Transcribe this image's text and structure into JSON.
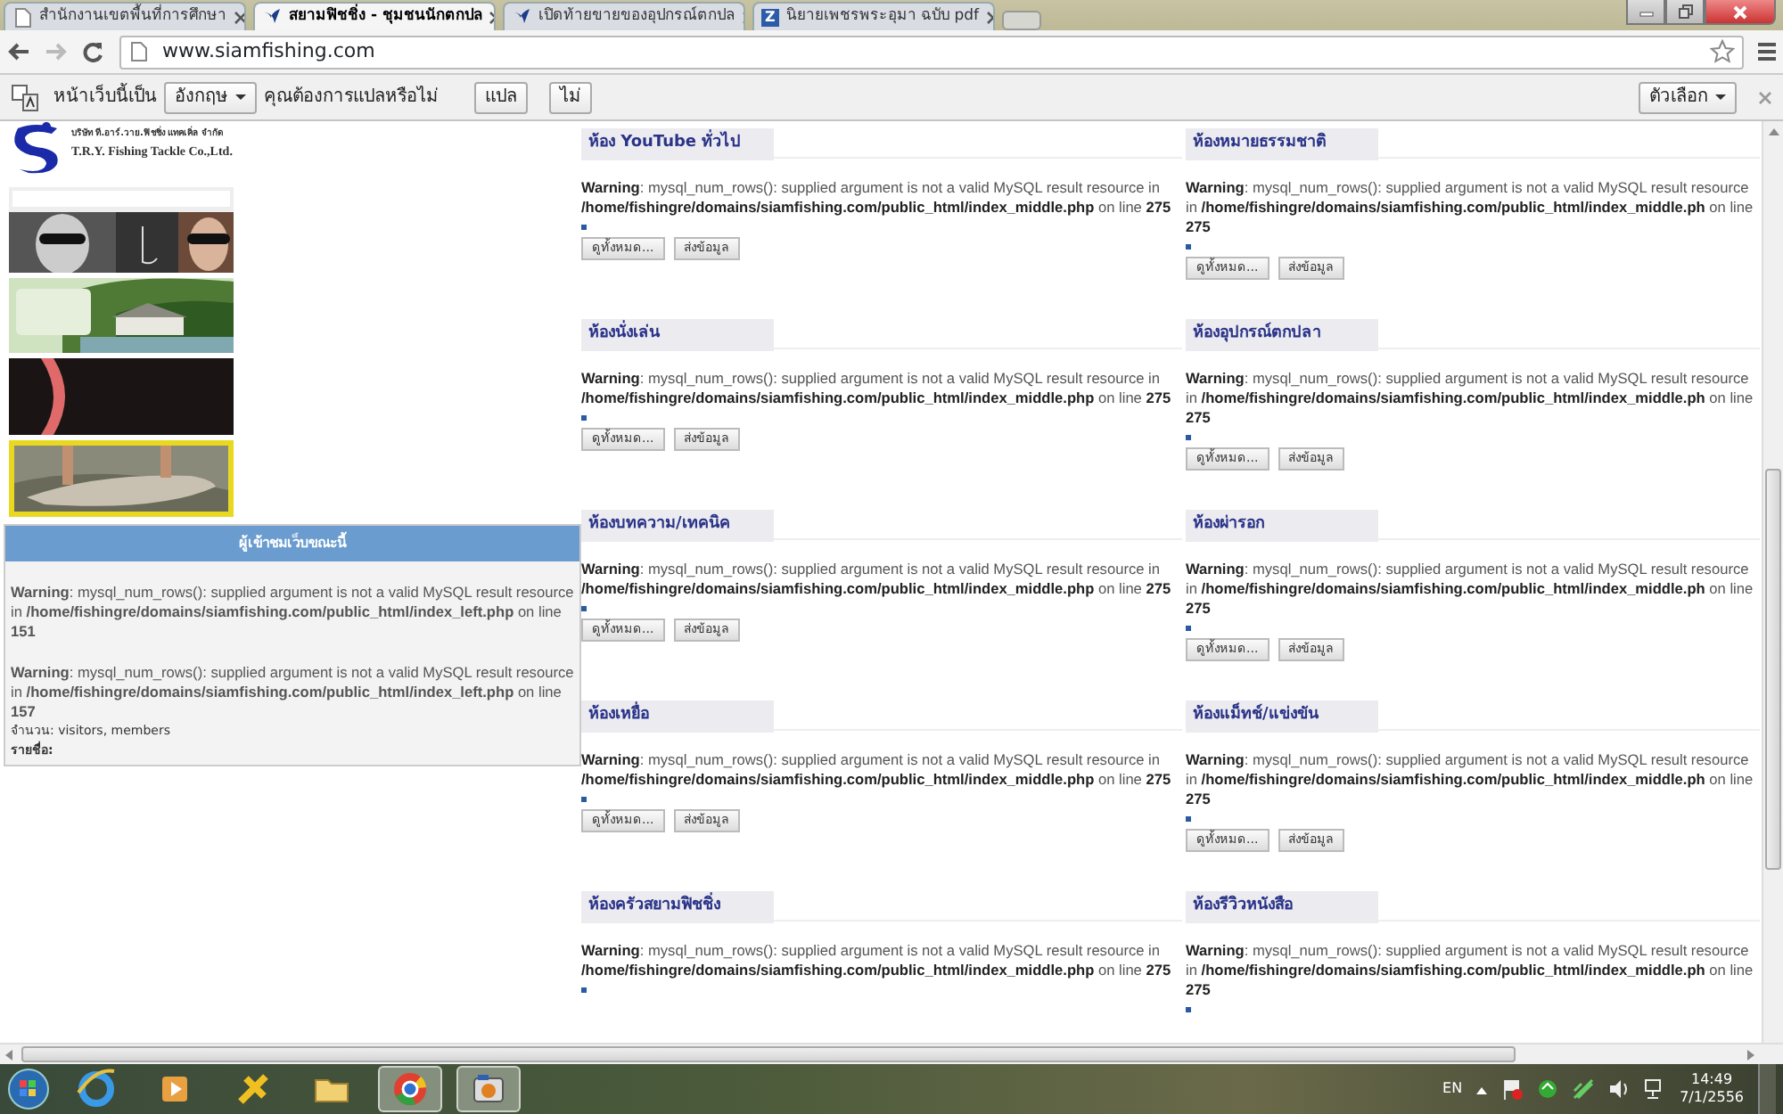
{
  "browser": {
    "tabs": [
      {
        "title": "สำนักงานเขตพื้นที่การศึกษา",
        "kind": "page",
        "selected": false
      },
      {
        "title": "สยามฟิชชิ่ง - ชุมชนนักตกปล",
        "kind": "bird",
        "selected": true
      },
      {
        "title": "เปิดท้ายขายของอุปกรณ์ตกปล",
        "kind": "bird",
        "selected": false
      },
      {
        "title": "นิยายเพชรพระอุมา ฉบับ pdf",
        "kind": "letter",
        "letter": "Z",
        "selected": false
      }
    ],
    "url": "www.siamfishing.com"
  },
  "translate_bar": {
    "prompt_start": "หน้าเว็บนี้เป็น",
    "language": "อังกฤษ",
    "prompt_end": "คุณต้องการแปลหรือไม่",
    "translate_button": "แปล",
    "no_button": "ไม่",
    "options_button": "ตัวเลือก"
  },
  "sidebar": {
    "logo_line_1": "บริษัท ที.อาร์.วาย.ฟิชชิ่ง แทคเคิ่ล จำกัด",
    "logo_line_2": "T.R.Y. Fishing Tackle Co.,Ltd.",
    "online_panel": {
      "title": "ผู้เข้าชมเว็บขณะนี้",
      "warnings": [
        "**Warning**: mysql_num_rows(): supplied argument is not a valid MySQL result resource in **/home/fishingre/domains/siamfishing.com/public_html/index_left.php** on line **151**",
        "**Warning**: mysql_num_rows(): supplied argument is not a valid MySQL result resource in **/home/fishingre/domains/siamfishing.com/public_html/index_left.php** on line **157**"
      ],
      "count_label": "จำนวน: visitors, members",
      "names_label": "รายชื่อ:"
    }
  },
  "rooms": [
    {
      "title": "ห้อง YouTube ทั่วไป",
      "warning": "**Warning**: mysql_num_rows(): supplied argument is not a valid MySQL result resource in **/home/fishingre/domains/siamfishing.com/public_html/index_middle.php** on line **275**",
      "buttons": [
        "ดูทั้งหมด...",
        "ส่งข้อมูล"
      ]
    },
    {
      "title": "ห้องหมายธรรมชาติ",
      "warning": "**Warning**: mysql_num_rows(): supplied argument is not a valid MySQL result resource in **/home/fishingre/domains/siamfishing.com/public_html/index_middle.ph** on line **275**",
      "buttons": [
        "ดูทั้งหมด...",
        "ส่งข้อมูล"
      ]
    },
    {
      "title": "ห้องนั่งเล่น",
      "warning": "**Warning**: mysql_num_rows(): supplied argument is not a valid MySQL result resource in **/home/fishingre/domains/siamfishing.com/public_html/index_middle.php** on line **275**",
      "buttons": [
        "ดูทั้งหมด...",
        "ส่งข้อมูล"
      ]
    },
    {
      "title": "ห้องอุปกรณ์ตกปลา",
      "warning": "**Warning**: mysql_num_rows(): supplied argument is not a valid MySQL result resource in **/home/fishingre/domains/siamfishing.com/public_html/index_middle.ph** on line **275**",
      "buttons": [
        "ดูทั้งหมด...",
        "ส่งข้อมูล"
      ]
    },
    {
      "title": "ห้องบทความ/เทคนิค",
      "warning": "**Warning**: mysql_num_rows(): supplied argument is not a valid MySQL result resource in **/home/fishingre/domains/siamfishing.com/public_html/index_middle.php** on line **275**",
      "buttons": [
        "ดูทั้งหมด...",
        "ส่งข้อมูล"
      ]
    },
    {
      "title": "ห้องผ่ารอก",
      "warning": "**Warning**: mysql_num_rows(): supplied argument is not a valid MySQL result resource in **/home/fishingre/domains/siamfishing.com/public_html/index_middle.ph** on line **275**",
      "buttons": [
        "ดูทั้งหมด...",
        "ส่งข้อมูล"
      ]
    },
    {
      "title": "ห้องเหยื่อ",
      "warning": "**Warning**: mysql_num_rows(): supplied argument is not a valid MySQL result resource in **/home/fishingre/domains/siamfishing.com/public_html/index_middle.php** on line **275**",
      "buttons": [
        "ดูทั้งหมด...",
        "ส่งข้อมูล"
      ]
    },
    {
      "title": "ห้องแม็ทช์/แข่งขัน",
      "warning": "**Warning**: mysql_num_rows(): supplied argument is not a valid MySQL result resource in **/home/fishingre/domains/siamfishing.com/public_html/index_middle.ph** on line **275**",
      "buttons": [
        "ดูทั้งหมด...",
        "ส่งข้อมูล"
      ]
    },
    {
      "title": "ห้องครัวสยามฟิชชิ่ง",
      "warning": "**Warning**: mysql_num_rows(): supplied argument is not a valid MySQL result resource in **/home/fishingre/domains/siamfishing.com/public_html/index_middle.php** on line **275**"
    },
    {
      "title": "ห้องรีวิวหนังสือ",
      "warning": "**Warning**: mysql_num_rows(): supplied argument is not a valid MySQL result resource in **/home/fishingre/domains/siamfishing.com/public_html/index_middle.ph** on line **275**"
    }
  ],
  "taskbar": {
    "apps": [
      {
        "kind": "ie",
        "active": false
      },
      {
        "kind": "media",
        "active": false
      },
      {
        "kind": "tool",
        "active": false
      },
      {
        "kind": "folder",
        "active": false
      },
      {
        "kind": "chrome",
        "active": true
      },
      {
        "kind": "camera",
        "active": true
      }
    ],
    "language": "EN",
    "time": "14:49",
    "date": "7/1/2556"
  }
}
